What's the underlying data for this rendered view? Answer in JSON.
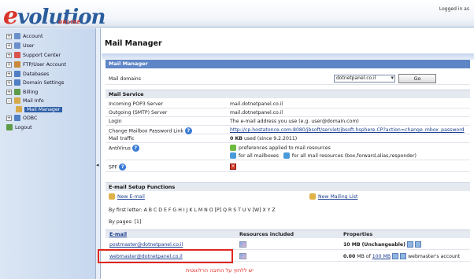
{
  "header": {
    "logo_text": "volution",
    "logo_sub": "ONLINE",
    "logged_in": "Logged in as"
  },
  "sidebar": {
    "items": [
      {
        "label": "Account",
        "icon": "account-icon",
        "color": "#6b8fc9"
      },
      {
        "label": "User",
        "icon": "user-icon",
        "color": "#6b8fc9"
      },
      {
        "label": "Support Center",
        "icon": "support-icon",
        "color": "#d9534f"
      },
      {
        "label": "FTP/User Account",
        "icon": "ftp-icon",
        "color": "#c98a3b"
      },
      {
        "label": "Databases",
        "icon": "database-icon",
        "color": "#4f7fc4"
      },
      {
        "label": "Domain Settings",
        "icon": "domain-icon",
        "color": "#4f7fc4"
      },
      {
        "label": "Billing",
        "icon": "billing-icon",
        "color": "#5e9c4a"
      },
      {
        "label": "Mail Info",
        "icon": "mail-icon",
        "color": "#d6a94a"
      },
      {
        "label": "Mail Manager",
        "icon": "mail-manager-icon",
        "color": "#d6a94a"
      },
      {
        "label": "ODBC",
        "icon": "odbc-icon",
        "color": "#4f7fc4"
      },
      {
        "label": "Logout",
        "icon": "logout-icon",
        "color": "#5e9c4a"
      }
    ]
  },
  "main": {
    "page_title": "Mail Manager",
    "panel_title": "Mail Manager",
    "mail_domains_label": "Mail domains",
    "domain_selected": "dotnetpanel.co.il",
    "go_label": "Go",
    "mail_service_title": "Mail Service",
    "service_rows": {
      "pop3_label": "Incoming POP3 Server",
      "pop3_value": "mail.dotnetpanel.co.il",
      "smtp_label": "Outgoing (SMTP) Server",
      "smtp_value": "mail.dotnetpanel.co.il",
      "login_label": "Login",
      "login_value": "The e-mail address you use (e.g. user@domain.com)",
      "change_pwd_label": "Change Mailbox Password Link",
      "change_pwd_value": "http://cp.hostatonce.com:8080/jbsoft/servlet/jbsoft.hsphere.CP?action=change_mbox_password",
      "traffic_label": "Mail traffic",
      "traffic_value_bold": "0 KB",
      "traffic_value_rest": "used (since 9.2.2011)",
      "antivirus_label": "AntiVirus",
      "antivirus_value": "preferences applied to mail resources",
      "antivirus_all_mailboxes": "for all mailboxes",
      "antivirus_all_resources": "for all mail resources (box,forward,alias,responder)",
      "spf_label": "SPF"
    },
    "setup_title": "E-mail Setup Functions",
    "new_email": "New E-mail",
    "new_mailing_list": "New Mailing List",
    "by_first_letter": "By first letter: A B C D E F G H I J K L M N O [P] Q R S T U V [W] X Y Z",
    "by_pages": "By pages: [1]",
    "table": {
      "col_email": "E-mail",
      "col_resources": "Resources included",
      "col_properties": "Properties",
      "rows": [
        {
          "email": "postmaster@dotnetpanel.co.il",
          "prop_bold": "10 MB",
          "prop_rest": "(Unchangeable)",
          "prop_tail": ""
        },
        {
          "email": "webmaster@dotnetpanel.co.il",
          "prop_bold": "0.00",
          "prop_rest": "MB of",
          "prop_link": "100 MB",
          "prop_tail": "webmaster's account"
        }
      ]
    },
    "annotation_note": "יש ללחוץ על התיבה הרלוונטית"
  }
}
